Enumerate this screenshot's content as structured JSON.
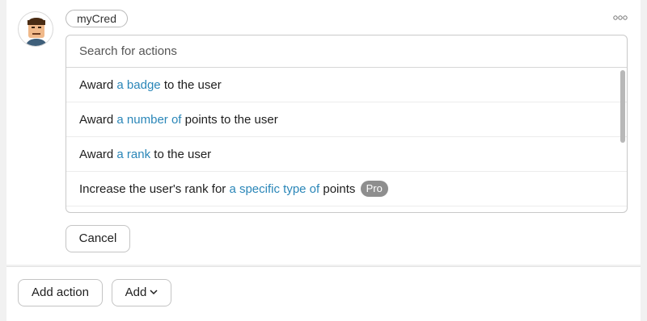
{
  "integration": {
    "name": "myCred"
  },
  "search": {
    "placeholder": "Search for actions"
  },
  "actions": [
    {
      "before": "Award ",
      "highlight": "a badge",
      "after": " to the user"
    },
    {
      "before": "Award ",
      "highlight": "a number of",
      "after": " points to the user"
    },
    {
      "before": "Award ",
      "highlight": "a rank",
      "after": " to the user"
    },
    {
      "before": "Increase the user's rank for ",
      "highlight": "a specific type of",
      "after": " points ",
      "badge": "Pro"
    }
  ],
  "buttons": {
    "cancel": "Cancel",
    "add_action": "Add action",
    "add": "Add"
  },
  "icons": {
    "more": "more-options-icon",
    "avatar": "user-avatar",
    "chevron": "chevron-down-icon"
  },
  "colors": {
    "highlight": "#2a86b8",
    "pro_badge": "#8e8e8e"
  }
}
